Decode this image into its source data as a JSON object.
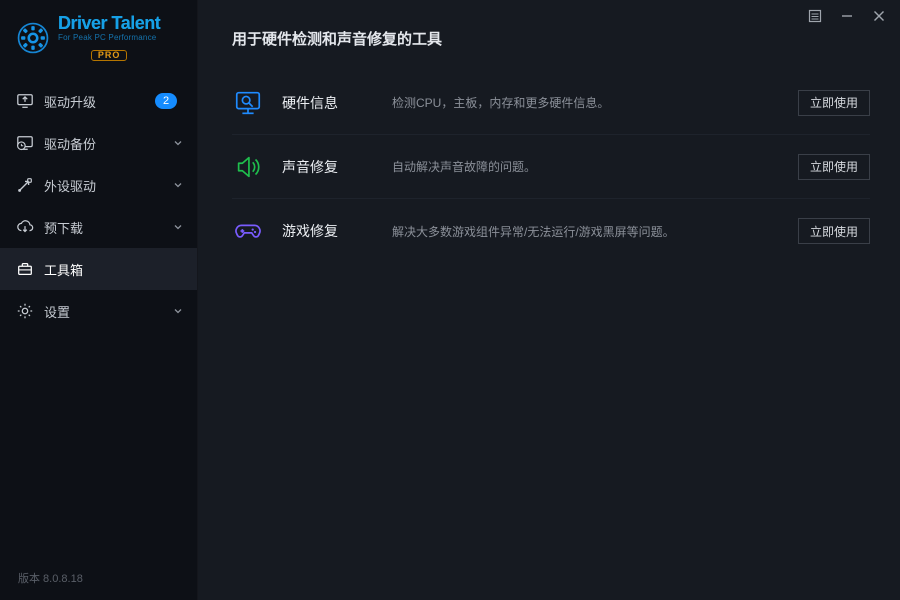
{
  "brand": {
    "title": "Driver Talent",
    "subtitle": "For Peak PC Performance",
    "edition": "PRO"
  },
  "sidebar": {
    "items": [
      {
        "label": "驱动升级",
        "badge": "2",
        "expandable": false
      },
      {
        "label": "驱动备份",
        "badge": null,
        "expandable": true
      },
      {
        "label": "外设驱动",
        "badge": null,
        "expandable": true
      },
      {
        "label": "预下载",
        "badge": null,
        "expandable": true
      },
      {
        "label": "工具箱",
        "badge": null,
        "expandable": false,
        "active": true
      },
      {
        "label": "设置",
        "badge": null,
        "expandable": true
      }
    ]
  },
  "version_label": "版本 8.0.8.18",
  "page": {
    "title": "用于硬件检测和声音修复的工具",
    "tools": [
      {
        "name": "硬件信息",
        "desc": "检测CPU，主板，内存和更多硬件信息。",
        "action": "立即使用"
      },
      {
        "name": "声音修复",
        "desc": "自动解决声音故障的问题。",
        "action": "立即使用"
      },
      {
        "name": "游戏修复",
        "desc": "解决大多数游戏组件异常/无法运行/游戏黑屏等问题。",
        "action": "立即使用"
      }
    ]
  }
}
